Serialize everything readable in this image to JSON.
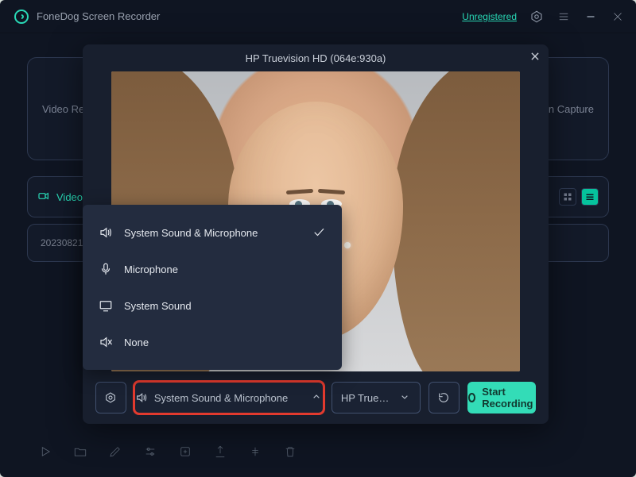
{
  "app": {
    "title": "FoneDog Screen Recorder",
    "unregistered_label": "Unregistered"
  },
  "background": {
    "tab_left": "Video Recorder",
    "tab_right": "Screen Capture",
    "toolbar_label": "Video",
    "row_date": "20230821"
  },
  "modal": {
    "title": "HP Truevision HD (064e:930a)",
    "audio_button_label": "System Sound & Microphone",
    "camera_button_label": "HP Truevi…",
    "start_button_label": "Start Recording"
  },
  "audio_menu": {
    "items": [
      {
        "label": "System Sound & Microphone",
        "icon": "speaker",
        "selected": true
      },
      {
        "label": "Microphone",
        "icon": "mic",
        "selected": false
      },
      {
        "label": "System Sound",
        "icon": "monitor",
        "selected": false
      },
      {
        "label": "None",
        "icon": "mute",
        "selected": false
      }
    ]
  }
}
